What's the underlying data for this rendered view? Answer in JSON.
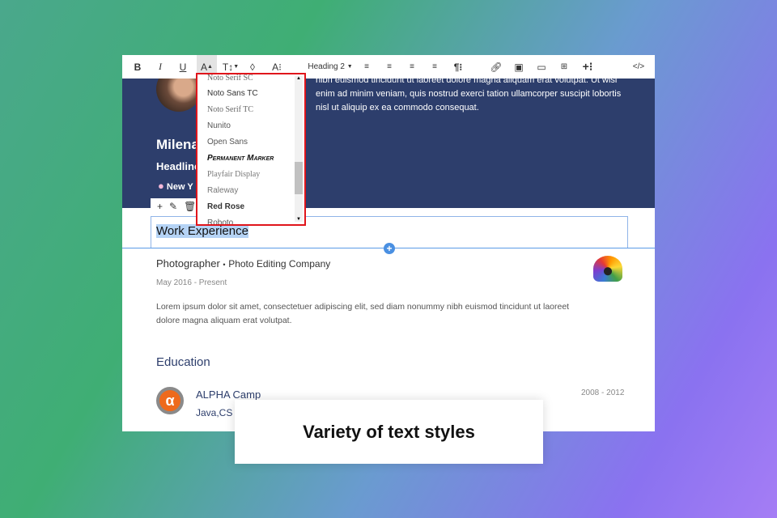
{
  "toolbar": {
    "bold": "B",
    "italic": "I",
    "underline": "U",
    "font_color": "A",
    "text_size": "T↕",
    "highlight": "◊",
    "font_style": "A⁝",
    "block_style": "Heading 2",
    "paragraph": "¶⁝",
    "insert_more": "+⁝",
    "code": "</>"
  },
  "font_dropdown": {
    "items": [
      "Noto Serif SC",
      "Noto Sans TC",
      "Noto Serif TC",
      "Nunito",
      "Open Sans",
      "Permanent Marker",
      "Playfair Display",
      "Raleway",
      "Red Rose",
      "Roboto"
    ]
  },
  "header": {
    "name": "Milena",
    "headline": "Headline",
    "location": "New Y",
    "bio": "nibh euismod tincidunt ut laoreet dolore magna aliquam erat volutpat. Ut wisi enim ad minim veniam, quis nostrud exerci tation ullamcorper suscipit lobortis nisl ut aliquip ex ea commodo consequat."
  },
  "section": {
    "title": "Work Experience",
    "plus": "+"
  },
  "job": {
    "title": "Photographer",
    "sep": "•",
    "company": "Photo Editing Company",
    "dates": "May 2016 - Present",
    "desc": "Lorem ipsum dolor sit amet, consectetuer adipiscing elit, sed diam nonummy nibh euismod tincidunt ut laoreet dolore magna aliquam erat volutpat."
  },
  "education": {
    "heading": "Education",
    "school": "ALPHA Camp",
    "detail": "Java,CS",
    "dates": "2008 - 2012"
  },
  "caption": "Variety of text styles"
}
